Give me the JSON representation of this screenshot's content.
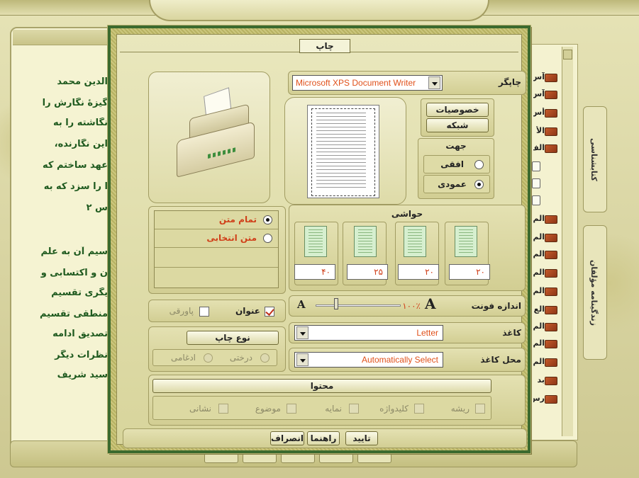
{
  "background": {
    "text_lines": [
      "الدین محمد",
      "گیزهٔ نگارش را",
      "نگاشته را به",
      "این نگارنده،",
      "عهد ساختم که",
      "ا را سزد که به",
      "س ۲",
      "سیم آن به علم",
      "ن و اکتسابی و",
      "یگری تقسیم",
      "منطقی تقسیم",
      "تصدیق ادامه",
      "نظرات دیگر",
      "سید شریف"
    ],
    "list_labels": [
      "آس",
      "آس",
      "أس",
      "أس",
      "الأ",
      "الف",
      "",
      "",
      "",
      "الم",
      "الم",
      "الم",
      "الم",
      "الم",
      "الع",
      "الم",
      "الم",
      "الم",
      "الم",
      "بد",
      "رس"
    ],
    "side_tabs": [
      "کتابشناسی",
      "زندگینامه مؤلفان"
    ]
  },
  "dialog": {
    "title": "چاپ",
    "printer_label": "چاپگر",
    "printer_value": "Microsoft XPS Document Writer",
    "properties_button": "خصوصیات",
    "network_button": "شبکه",
    "orientation": {
      "title": "جهت",
      "landscape": "افقی",
      "portrait": "عمودی",
      "selected": "portrait"
    },
    "range": {
      "all_text": "تمام متن",
      "selected_text": "متن انتخابی",
      "selected": "all_text"
    },
    "margins": {
      "title": "حواشی",
      "values": [
        "۴۰",
        "۲۵",
        "۲۰",
        "۲۰"
      ]
    },
    "font_size": {
      "label": "اندازه فونت",
      "small_a": "A",
      "large_a": "A",
      "value": "۱۰۰٪"
    },
    "title_check": {
      "label": "عنوان",
      "checked": true
    },
    "footnote_check": {
      "label": "پاورقی",
      "checked": false
    },
    "paper": {
      "label": "کاغذ",
      "value": "Letter"
    },
    "paper_source": {
      "label": "محل کاغذ",
      "value": "Automatically Select"
    },
    "print_type": {
      "title": "نوع چاپ",
      "tree": "درختی",
      "merged": "ادغامی"
    },
    "content": {
      "title": "محتوا",
      "items": [
        "ریشه",
        "کلیدواژه",
        "نمایه",
        "موضوع",
        "نشانی"
      ]
    },
    "buttons": {
      "ok": "تایید",
      "help": "راهنما",
      "cancel": "انصراف"
    }
  }
}
